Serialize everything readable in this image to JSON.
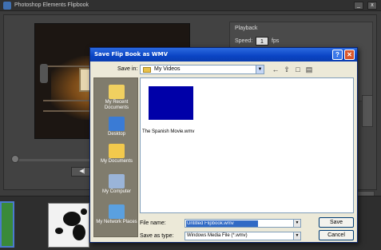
{
  "app": {
    "title": "Photoshop Elements Flipbook",
    "playback_label": "Playback",
    "speed_label": "Speed:",
    "speed_value": "1",
    "speed_unit": "fps",
    "play_button": "◀|"
  },
  "dialog": {
    "title": "Save Flip Book as WMV",
    "help": "?",
    "close": "✕",
    "save_in_label": "Save in:",
    "save_in_value": "My Videos",
    "places": [
      {
        "label": "My Recent Documents",
        "icon": "recent-documents-icon",
        "color": "#f0d060"
      },
      {
        "label": "Desktop",
        "icon": "desktop-icon",
        "color": "#3a7bd5"
      },
      {
        "label": "My Documents",
        "icon": "my-documents-icon",
        "color": "#f2c94c"
      },
      {
        "label": "My Computer",
        "icon": "my-computer-icon",
        "color": "#9ab4d8"
      },
      {
        "label": "My Network Places",
        "icon": "network-places-icon",
        "color": "#5aa0e0"
      }
    ],
    "file": {
      "name": "The Spanish Movie.wmv",
      "thumb_color": "#0000a8"
    },
    "file_name_label": "File name:",
    "file_name_value": "Untitled Flipbook.wmv",
    "save_as_type_label": "Save as type:",
    "save_as_type_value": "Windows Media File (*.wmv)",
    "save_button": "Save",
    "cancel_button": "Cancel"
  },
  "colors": {
    "dialog_title_bar": "#0a44c4",
    "selection": "#316ac5",
    "places_bar": "#807c6d"
  }
}
